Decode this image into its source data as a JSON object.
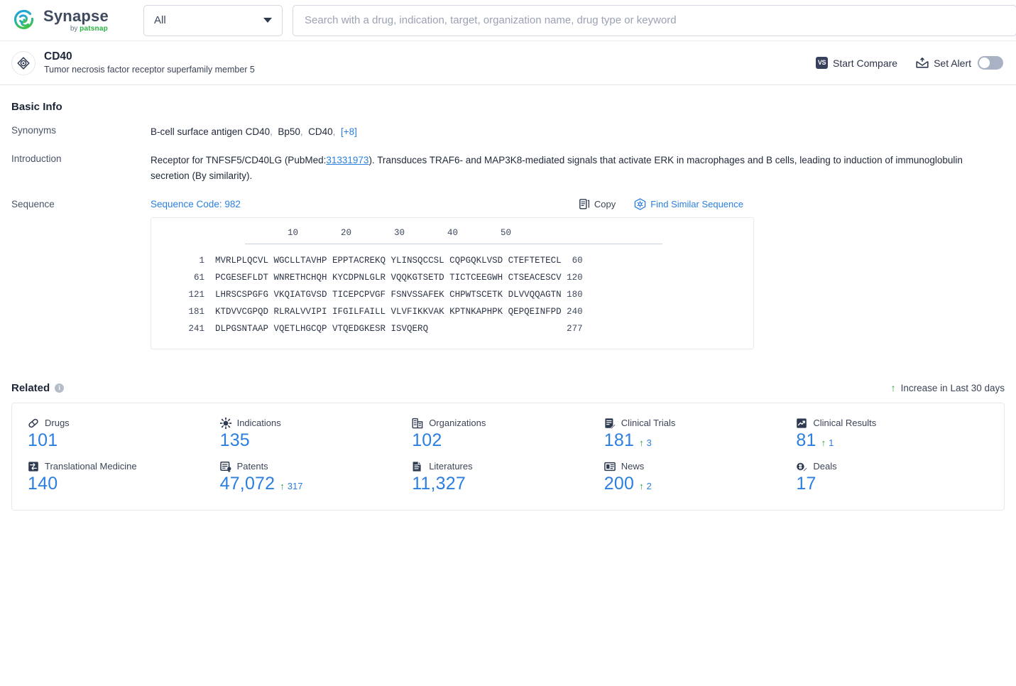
{
  "topbar": {
    "logo_name": "Synapse",
    "logo_by": "by ",
    "logo_brand": "patsnap",
    "category_selected": "All",
    "search_placeholder": "Search with a drug, indication, target, organization name, drug type or keyword",
    "search_value": ""
  },
  "entity": {
    "name": "CD40",
    "description": "Tumor necrosis factor receptor superfamily member 5",
    "start_compare_label": "Start Compare",
    "vs_badge": "VS",
    "set_alert_label": "Set Alert",
    "alert_enabled": false
  },
  "basic_info": {
    "section_title": "Basic Info",
    "synonyms_label": "Synonyms",
    "synonyms": [
      "B-cell surface antigen CD40",
      "Bp50",
      "CD40"
    ],
    "synonyms_more": "[+8]",
    "introduction_label": "Introduction",
    "introduction_part1": "Receptor for TNFSF5/CD40LG (PubMed:",
    "introduction_link": "31331973",
    "introduction_part2": "). Transduces TRAF6- and MAP3K8-mediated signals that activate ERK in macrophages and B cells, leading to induction of immunoglobulin secretion (By similarity).",
    "sequence_label": "Sequence"
  },
  "sequence": {
    "code_label": "Sequence Code: 982",
    "copy_label": "Copy",
    "find_similar_label": "Find Similar Sequence",
    "ruler": "        10        20        30        40        50",
    "rows": [
      {
        "start": "  1",
        "blocks": [
          "MVRLPLQCVL",
          "WGCLLTAVHP",
          "EPPTACREKQ",
          "YLINSQCCSL",
          "CQPGQKLVSD",
          "CTEFTETECL"
        ],
        "end": " 60"
      },
      {
        "start": " 61",
        "blocks": [
          "PCGESEFLDT",
          "WNRETHCHQH",
          "KYCDPNLGLR",
          "VQQKGTSETD",
          "TICTCEEGWH",
          "CTSEACESCV"
        ],
        "end": "120"
      },
      {
        "start": "121",
        "blocks": [
          "LHRSCSPGFG",
          "VKQIATGVSD",
          "TICEPCPVGF",
          "FSNVSSAFEK",
          "CHPWTSCETK",
          "DLVVQQAGTN"
        ],
        "end": "180"
      },
      {
        "start": "181",
        "blocks": [
          "KTDVVCGPQD",
          "RLRALVVIPI",
          "IFGILFAILL",
          "VLVFIKKVAK",
          "KPTNKAPHPK",
          "QEPQEINFPD"
        ],
        "end": "240"
      },
      {
        "start": "241",
        "blocks": [
          "DLPGSNTAAP",
          "VQETLHGCQP",
          "VTQEDGKESR",
          "ISVQERQ"
        ],
        "end": "277"
      }
    ]
  },
  "related": {
    "title": "Related",
    "info_glyph": "i",
    "increase_note": "Increase in Last 30 days",
    "items": [
      {
        "icon": "pill-icon",
        "label": "Drugs",
        "value": "101",
        "delta": ""
      },
      {
        "icon": "virus-icon",
        "label": "Indications",
        "value": "135",
        "delta": ""
      },
      {
        "icon": "building-icon",
        "label": "Organizations",
        "value": "102",
        "delta": ""
      },
      {
        "icon": "trial-icon",
        "label": "Clinical Trials",
        "value": "181",
        "delta": "3"
      },
      {
        "icon": "results-icon",
        "label": "Clinical Results",
        "value": "81",
        "delta": "1"
      },
      {
        "icon": "translate-icon",
        "label": "Translational Medicine",
        "value": "140",
        "delta": ""
      },
      {
        "icon": "patent-icon",
        "label": "Patents",
        "value": "47,072",
        "delta": "317"
      },
      {
        "icon": "literature-icon",
        "label": "Literatures",
        "value": "11,327",
        "delta": ""
      },
      {
        "icon": "news-icon",
        "label": "News",
        "value": "200",
        "delta": "2"
      },
      {
        "icon": "deal-icon",
        "label": "Deals",
        "value": "17",
        "delta": ""
      }
    ]
  },
  "colors": {
    "accent_blue": "#2a7fe0",
    "increase_green": "#2aa03c",
    "logo_blue": "#2196d6",
    "logo_green": "#3fbf4f",
    "dark_navy": "#37415c"
  }
}
